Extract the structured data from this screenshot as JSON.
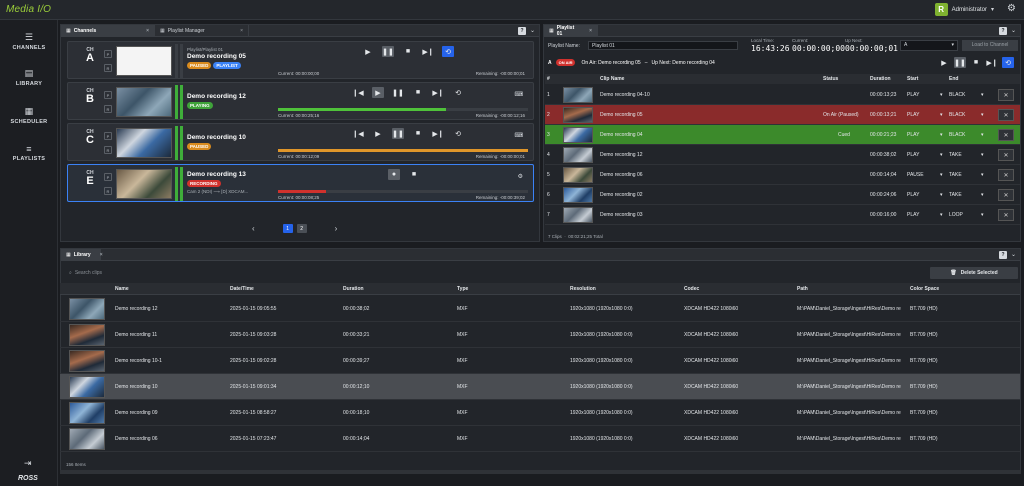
{
  "app": {
    "logo": "Media I/O",
    "user_initial": "R",
    "user_name": "Administrator"
  },
  "sidebar": {
    "items": [
      {
        "label": "CHANNELS",
        "icon": "channels-icon"
      },
      {
        "label": "LIBRARY",
        "icon": "library-icon"
      },
      {
        "label": "SCHEDULER",
        "icon": "scheduler-icon"
      },
      {
        "label": "PLAYLISTS",
        "icon": "playlists-icon"
      }
    ],
    "footer_brand": "ROSS"
  },
  "channels_panel": {
    "tabs": [
      "Channels",
      "Playlist Manager"
    ],
    "channels": [
      {
        "ch": "CH",
        "letter": "A",
        "playlist": "Playlist/Playlist 01",
        "clip": "Demo recording 05",
        "badges": [
          "PAUSED",
          "PLAYLIST"
        ],
        "current": "Current: 00:00:00;00",
        "remaining": "Remaining: -00:00:00;01",
        "progress": 0.0
      },
      {
        "ch": "CH",
        "letter": "B",
        "playlist": "",
        "clip": "Demo recording 12",
        "badges": [
          "PLAYING"
        ],
        "current": "Current: 00:00:25;16",
        "remaining": "Remaining: -00:00:12;16",
        "progress": 0.67
      },
      {
        "ch": "CH",
        "letter": "C",
        "playlist": "",
        "clip": "Demo recording 10",
        "badges": [
          "PAUSED"
        ],
        "current": "Current: 00:00:12;09",
        "remaining": "Remaining: -00:00:00;01",
        "progress": 1.0
      },
      {
        "ch": "CH",
        "letter": "E",
        "playlist": "",
        "clip": "Demo recording 13",
        "badges": [
          "RECORDING"
        ],
        "sub": "Cam 2 (NDI) ⟶ [D] XDCAM...",
        "current": "Current: 00:00:08;25",
        "remaining": "Remaining: -00:00:39;02",
        "progress": 0.19
      }
    ],
    "pages": [
      "1",
      "2"
    ]
  },
  "playlist_panel": {
    "tab": "Playlist 01",
    "name_label": "Playlist Name:",
    "name_value": "Playlist 01",
    "local_time_label": "Local Time:",
    "local_time": "16:43:26",
    "current_label": "Current:",
    "current": "00:00:00;00",
    "upnext_label": "Up Next:",
    "upnext": "00:00:00;01",
    "channel_select": "A",
    "load_button": "Load to Channel",
    "status_line_a": "A",
    "status_badge": "ON AIR",
    "on_air_text": "On Air: Demo recording 05",
    "up_next_text": "Up Next: Demo recording 04",
    "columns": [
      "#",
      "Clip Name",
      "Status",
      "Duration",
      "Start",
      "End"
    ],
    "rows": [
      {
        "n": "1",
        "name": "Demo recording 04-10",
        "status": "",
        "duration": "00:00:13;23",
        "start": "PLAY",
        "end": "BLACK"
      },
      {
        "n": "2",
        "name": "Demo recording 05",
        "status": "On Air (Paused)",
        "duration": "00:00:13;21",
        "start": "PLAY",
        "end": "BLACK"
      },
      {
        "n": "3",
        "name": "Demo recording 04",
        "status": "Cued",
        "duration": "00:00:21;23",
        "start": "PLAY",
        "end": "BLACK"
      },
      {
        "n": "4",
        "name": "Demo recording 12",
        "status": "",
        "duration": "00:00:38;02",
        "start": "PLAY",
        "end": "TAKE"
      },
      {
        "n": "5",
        "name": "Demo recording 06",
        "status": "",
        "duration": "00:00:14;04",
        "start": "PAUSE",
        "end": "TAKE"
      },
      {
        "n": "6",
        "name": "Demo recording 02",
        "status": "",
        "duration": "00:00:24;06",
        "start": "PLAY",
        "end": "TAKE"
      },
      {
        "n": "7",
        "name": "Demo recording 03",
        "status": "",
        "duration": "00:00:16;00",
        "start": "PLAY",
        "end": "LOOP"
      }
    ],
    "footer": "7 Clips",
    "footer_total": "00:02:21;25 Total"
  },
  "library_panel": {
    "tab": "Library",
    "search_placeholder": "Search clips",
    "delete_button": "Delete Selected",
    "columns": [
      "Name",
      "Date/Time",
      "Duration",
      "Type",
      "Resolution",
      "Codec",
      "Path",
      "Color Space"
    ],
    "rows": [
      {
        "name": "Demo recording 12",
        "date": "2025-01-15 09:05:55",
        "duration": "00:00:38;02",
        "type": "MXF",
        "resolution": "1920x1080 (1920x1080 0:0)",
        "codec": "XDCAM HD422 1080i60",
        "path": "M:\\PAM\\Daniel_Storage\\Ingest\\HiRes\\Demo re",
        "color": "BT.709 (HD)"
      },
      {
        "name": "Demo recording 11",
        "date": "2025-01-15 09:03:28",
        "duration": "00:00:33;21",
        "type": "MXF",
        "resolution": "1920x1080 (1920x1080 0:0)",
        "codec": "XDCAM HD422 1080i60",
        "path": "M:\\PAM\\Daniel_Storage\\Ingest\\HiRes\\Demo re",
        "color": "BT.709 (HD)"
      },
      {
        "name": "Demo recording 10-1",
        "date": "2025-01-15 09:02:28",
        "duration": "00:00:39;27",
        "type": "MXF",
        "resolution": "1920x1080 (1920x1080 0:0)",
        "codec": "XDCAM HD422 1080i60",
        "path": "M:\\PAM\\Daniel_Storage\\Ingest\\HiRes\\Demo re",
        "color": "BT.709 (HD)"
      },
      {
        "name": "Demo recording 10",
        "date": "2025-01-15 09:01:34",
        "duration": "00:00:12;10",
        "type": "MXF",
        "resolution": "1920x1080 (1920x1080 0:0)",
        "codec": "XDCAM HD422 1080i60",
        "path": "M:\\PAM\\Daniel_Storage\\Ingest\\HiRes\\Demo re",
        "color": "BT.709 (HD)"
      },
      {
        "name": "Demo recording 09",
        "date": "2025-01-15 08:58:27",
        "duration": "00:00:18;10",
        "type": "MXF",
        "resolution": "1920x1080 (1920x1080 0:0)",
        "codec": "XDCAM HD422 1080i60",
        "path": "M:\\PAM\\Daniel_Storage\\Ingest\\HiRes\\Demo re",
        "color": "BT.709 (HD)"
      },
      {
        "name": "Demo recording 06",
        "date": "2025-01-15 07:23:47",
        "duration": "00:00:14;04",
        "type": "MXF",
        "resolution": "1920x1080 (1920x1080 0:0)",
        "codec": "XDCAM HD422 1080i60",
        "path": "M:\\PAM\\Daniel_Storage\\Ingest\\HiRes\\Demo re",
        "color": "BT.709 (HD)"
      }
    ],
    "footer": "156 Items"
  }
}
